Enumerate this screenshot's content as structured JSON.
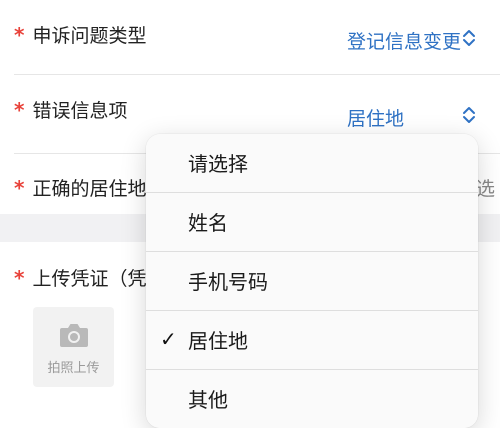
{
  "form": {
    "required_mark": "*",
    "complaint_type": {
      "label": "申诉问题类型",
      "value": "登记信息变更"
    },
    "wrong_info_item": {
      "label": "错误信息项",
      "value": "居住地"
    },
    "correct_address": {
      "label": "正确的居住地",
      "value": "选"
    },
    "upload": {
      "label": "上传凭证（凭",
      "photo_button_label": "拍照上传"
    }
  },
  "dropdown": {
    "selected": "居住地",
    "check_mark": "✓",
    "options": [
      "请选择",
      "姓名",
      "手机号码",
      "居住地",
      "其他"
    ]
  },
  "colors": {
    "accent": "#2f72c4",
    "required": "#e8423a"
  },
  "icons": {
    "chevron": "chevron-up-down-icon",
    "camera": "camera-icon"
  }
}
